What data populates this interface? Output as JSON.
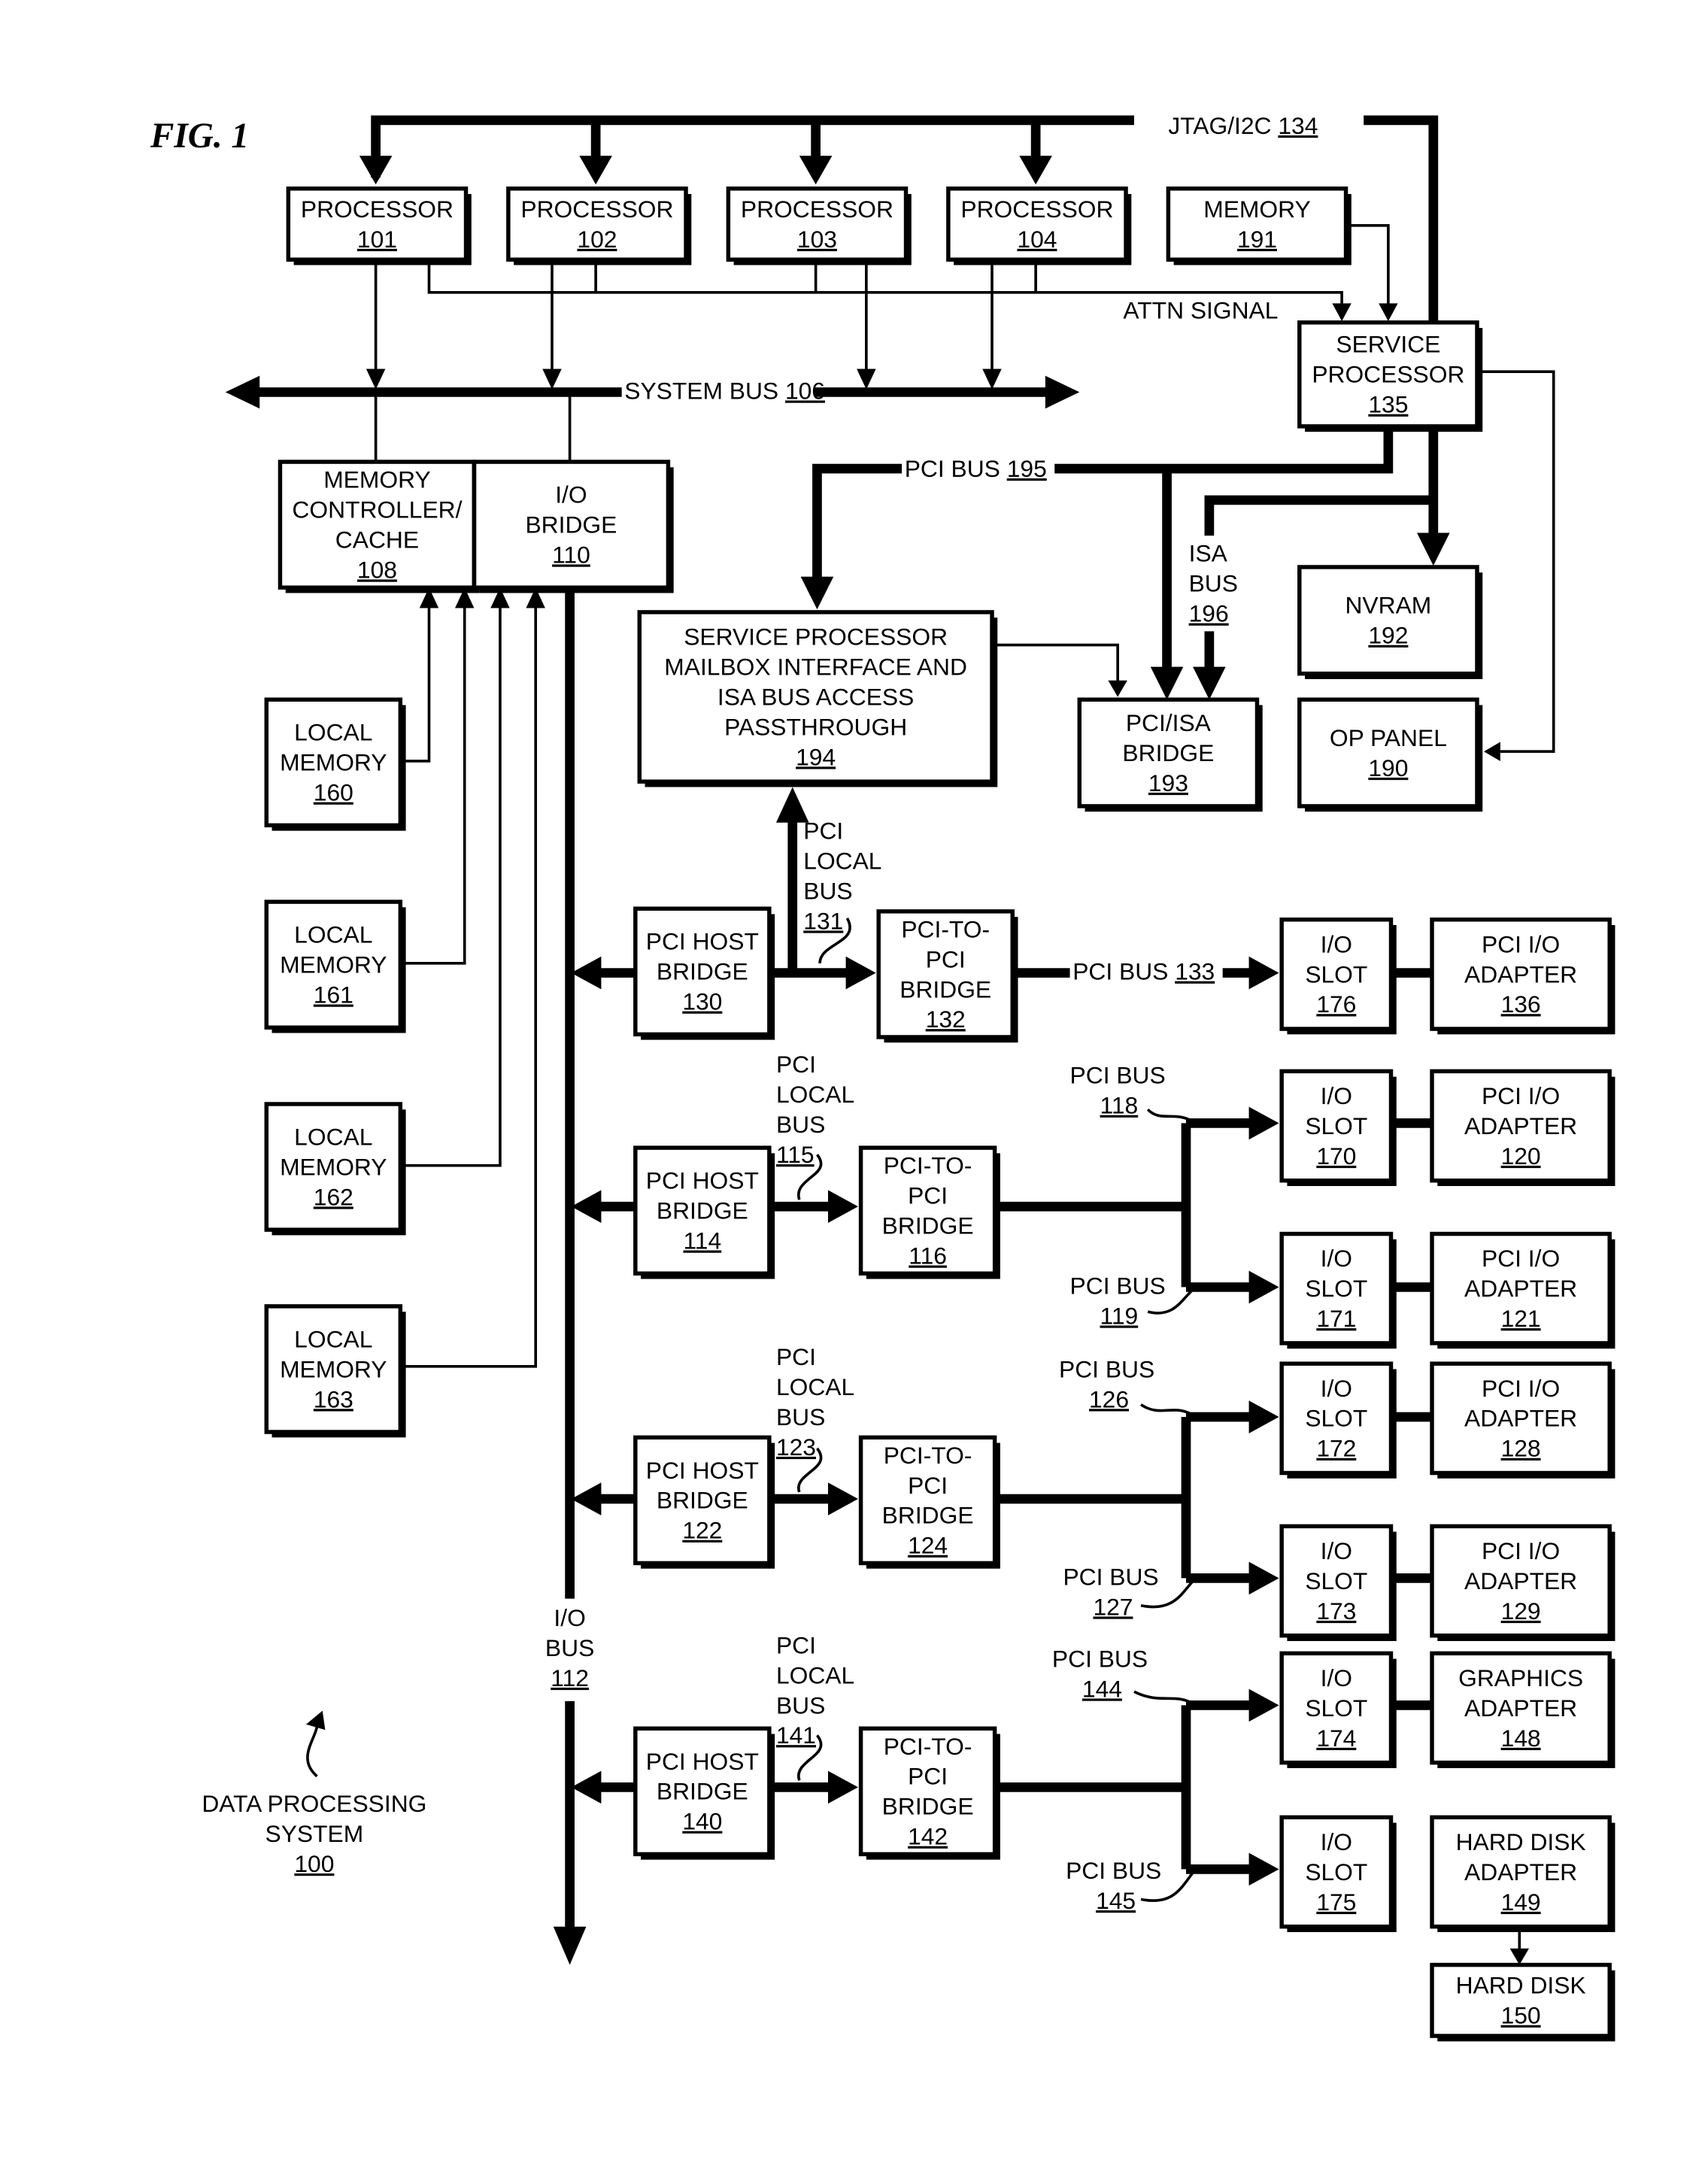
{
  "figure_label": "FIG. 1",
  "boxes": {
    "p101": [
      "PROCESSOR",
      "101"
    ],
    "p102": [
      "PROCESSOR",
      "102"
    ],
    "p103": [
      "PROCESSOR",
      "103"
    ],
    "p104": [
      "PROCESSOR",
      "104"
    ],
    "mem191": [
      "MEMORY",
      "191"
    ],
    "sp135": [
      "SERVICE",
      "PROCESSOR",
      "135"
    ],
    "mc108": [
      "MEMORY",
      "CONTROLLER/",
      "CACHE",
      "108"
    ],
    "iob110": [
      "I/O",
      "BRIDGE",
      "110"
    ],
    "spm194": [
      "SERVICE PROCESSOR",
      "MAILBOX INTERFACE AND",
      "ISA BUS ACCESS",
      "PASSTHROUGH",
      "194"
    ],
    "pisa193": [
      "PCI/ISA",
      "BRIDGE",
      "193"
    ],
    "nvram192": [
      "NVRAM",
      "192"
    ],
    "op190": [
      "OP PANEL",
      "190"
    ],
    "lm160": [
      "LOCAL",
      "MEMORY",
      "160"
    ],
    "lm161": [
      "LOCAL",
      "MEMORY",
      "161"
    ],
    "lm162": [
      "LOCAL",
      "MEMORY",
      "162"
    ],
    "lm163": [
      "LOCAL",
      "MEMORY",
      "163"
    ],
    "phb130": [
      "PCI HOST",
      "BRIDGE",
      "130"
    ],
    "ppb132": [
      "PCI-TO-",
      "PCI",
      "BRIDGE",
      "132"
    ],
    "slot176": [
      "I/O",
      "SLOT",
      "176"
    ],
    "ad136": [
      "PCI I/O",
      "ADAPTER",
      "136"
    ],
    "phb114": [
      "PCI HOST",
      "BRIDGE",
      "114"
    ],
    "ppb116": [
      "PCI-TO-",
      "PCI",
      "BRIDGE",
      "116"
    ],
    "slot170": [
      "I/O",
      "SLOT",
      "170"
    ],
    "ad120": [
      "PCI I/O",
      "ADAPTER",
      "120"
    ],
    "slot171": [
      "I/O",
      "SLOT",
      "171"
    ],
    "ad121": [
      "PCI I/O",
      "ADAPTER",
      "121"
    ],
    "phb122": [
      "PCI HOST",
      "BRIDGE",
      "122"
    ],
    "ppb124": [
      "PCI-TO-",
      "PCI",
      "BRIDGE",
      "124"
    ],
    "slot172": [
      "I/O",
      "SLOT",
      "172"
    ],
    "ad128": [
      "PCI I/O",
      "ADAPTER",
      "128"
    ],
    "slot173": [
      "I/O",
      "SLOT",
      "173"
    ],
    "ad129": [
      "PCI I/O",
      "ADAPTER",
      "129"
    ],
    "phb140": [
      "PCI HOST",
      "BRIDGE",
      "140"
    ],
    "ppb142": [
      "PCI-TO-",
      "PCI",
      "BRIDGE",
      "142"
    ],
    "slot174": [
      "I/O",
      "SLOT",
      "174"
    ],
    "ga148": [
      "GRAPHICS",
      "ADAPTER",
      "148"
    ],
    "slot175": [
      "I/O",
      "SLOT",
      "175"
    ],
    "hda149": [
      "HARD DISK",
      "ADAPTER",
      "149"
    ],
    "hd150": [
      "HARD DISK",
      "150"
    ]
  },
  "labels": {
    "jtag": [
      "JTAG/I2C",
      "134"
    ],
    "attn": [
      "ATTN SIGNAL"
    ],
    "sysbus": [
      "SYSTEM BUS",
      "106"
    ],
    "pcibus195": [
      "PCI BUS",
      "195"
    ],
    "isabus196": [
      "ISA",
      "BUS",
      "196"
    ],
    "pcilocal131": [
      "PCI",
      "LOCAL",
      "BUS",
      "131"
    ],
    "pcibus133": [
      "PCI BUS",
      "133"
    ],
    "pcilocal115": [
      "PCI",
      "LOCAL",
      "BUS",
      "115"
    ],
    "pcibus118": [
      "PCI BUS",
      "118"
    ],
    "pcibus119": [
      "PCI BUS",
      "119"
    ],
    "pcilocal123": [
      "PCI",
      "LOCAL",
      "BUS",
      "123"
    ],
    "pcibus126": [
      "PCI BUS",
      "126"
    ],
    "pcibus127": [
      "PCI BUS",
      "127"
    ],
    "pcilocal141": [
      "PCI",
      "LOCAL",
      "BUS",
      "141"
    ],
    "pcibus144": [
      "PCI BUS",
      "144"
    ],
    "pcibus145": [
      "PCI BUS",
      "145"
    ],
    "iobus112": [
      "I/O",
      "BUS",
      "112"
    ],
    "dps100": [
      "DATA PROCESSING",
      "SYSTEM",
      "100"
    ]
  }
}
